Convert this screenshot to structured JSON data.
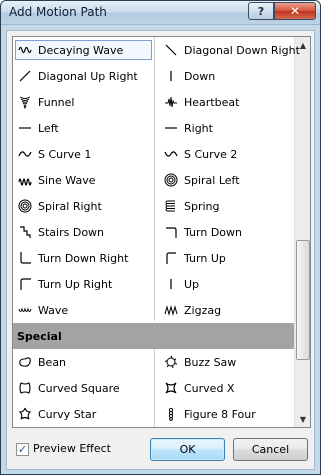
{
  "window": {
    "title": "Add Motion Path",
    "help_label": "?",
    "close_label": "✕"
  },
  "list": {
    "rows": [
      {
        "left": {
          "label": "Decaying Wave",
          "icon": "decaying-wave-icon"
        },
        "right": {
          "label": "Diagonal Down Right",
          "icon": "diagonal-down-right-icon"
        }
      },
      {
        "left": {
          "label": "Diagonal Up Right",
          "icon": "diagonal-up-right-icon"
        },
        "right": {
          "label": "Down",
          "icon": "down-icon"
        }
      },
      {
        "left": {
          "label": "Funnel",
          "icon": "funnel-icon"
        },
        "right": {
          "label": "Heartbeat",
          "icon": "heartbeat-icon"
        }
      },
      {
        "left": {
          "label": "Left",
          "icon": "left-icon"
        },
        "right": {
          "label": "Right",
          "icon": "right-icon"
        }
      },
      {
        "left": {
          "label": "S Curve 1",
          "icon": "s-curve-1-icon"
        },
        "right": {
          "label": "S Curve 2",
          "icon": "s-curve-2-icon"
        }
      },
      {
        "left": {
          "label": "Sine Wave",
          "icon": "sine-wave-icon"
        },
        "right": {
          "label": "Spiral Left",
          "icon": "spiral-left-icon"
        }
      },
      {
        "left": {
          "label": "Spiral Right",
          "icon": "spiral-right-icon"
        },
        "right": {
          "label": "Spring",
          "icon": "spring-icon"
        }
      },
      {
        "left": {
          "label": "Stairs Down",
          "icon": "stairs-down-icon"
        },
        "right": {
          "label": "Turn Down",
          "icon": "turn-down-icon"
        }
      },
      {
        "left": {
          "label": "Turn Down Right",
          "icon": "turn-down-right-icon"
        },
        "right": {
          "label": "Turn Up",
          "icon": "turn-up-icon"
        }
      },
      {
        "left": {
          "label": "Turn Up Right",
          "icon": "turn-up-right-icon"
        },
        "right": {
          "label": "Up",
          "icon": "up-icon"
        }
      },
      {
        "left": {
          "label": "Wave",
          "icon": "wave-icon"
        },
        "right": {
          "label": "Zigzag",
          "icon": "zigzag-icon"
        }
      }
    ],
    "section_header": "Special",
    "special_rows": [
      {
        "left": {
          "label": "Bean",
          "icon": "bean-icon"
        },
        "right": {
          "label": "Buzz Saw",
          "icon": "buzz-saw-icon"
        }
      },
      {
        "left": {
          "label": "Curved Square",
          "icon": "curved-square-icon"
        },
        "right": {
          "label": "Curved X",
          "icon": "curved-x-icon"
        }
      },
      {
        "left": {
          "label": "Curvy Star",
          "icon": "curvy-star-icon"
        },
        "right": {
          "label": "Figure 8 Four",
          "icon": "figure-8-four-icon"
        }
      }
    ],
    "selected": "Decaying Wave"
  },
  "footer": {
    "preview_label": "Preview Effect",
    "preview_checked": true,
    "ok_label": "OK",
    "cancel_label": "Cancel"
  }
}
